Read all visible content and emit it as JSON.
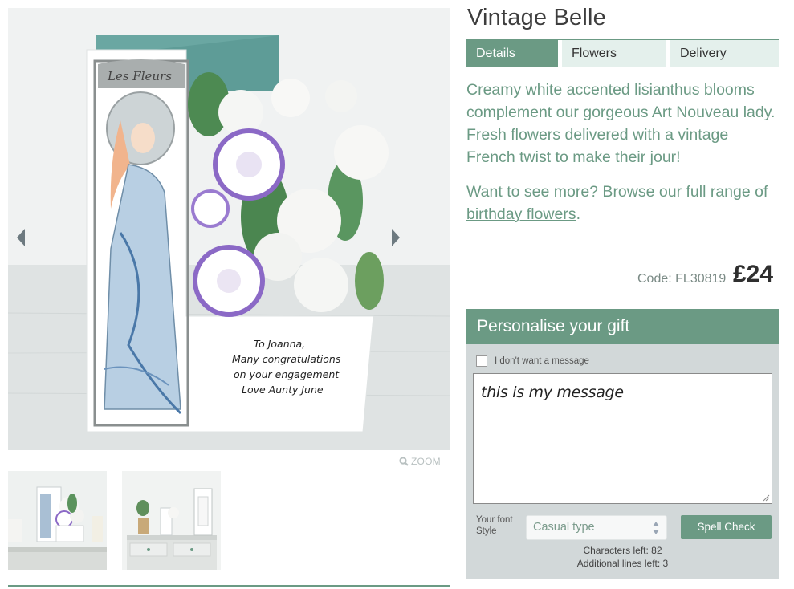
{
  "product": {
    "title": "Vintage Belle",
    "tabs": [
      {
        "label": "Details",
        "active": true
      },
      {
        "label": "Flowers",
        "active": false
      },
      {
        "label": "Delivery",
        "active": false
      }
    ],
    "description": "Creamy white accented lisianthus blooms complement our gorgeous Art Nouveau lady. Fresh flowers delivered with a vintage French twist to make their jour!",
    "more_prefix": "Want to see more? Browse our full range of ",
    "more_link": "birthday flowers",
    "more_suffix": ".",
    "code": "Code: FL30819",
    "price": "£24"
  },
  "gallery": {
    "zoom_label": "ZOOM",
    "card_title": "Les Fleurs",
    "card_message": [
      "To Joanna,",
      "Many congratulations",
      "on your engagement",
      "Love Aunty June"
    ]
  },
  "personalise": {
    "heading": "Personalise your gift",
    "no_message_label": "I don't want a message",
    "message_value": "this is my message",
    "font_label": "Your font Style",
    "font_selected": "Casual type",
    "spell_check_label": "Spell Check",
    "chars_left": "Characters left: 82",
    "lines_left": "Additional lines left: 3"
  },
  "colors": {
    "accent": "#6b9a84",
    "tab_inactive": "#e4f0ec",
    "panel_bg": "#d2d8d9"
  },
  "icons": {
    "prev": "chevron-left-icon",
    "next": "chevron-right-icon",
    "zoom": "magnifier-icon",
    "select": "up-down-arrows-icon"
  }
}
